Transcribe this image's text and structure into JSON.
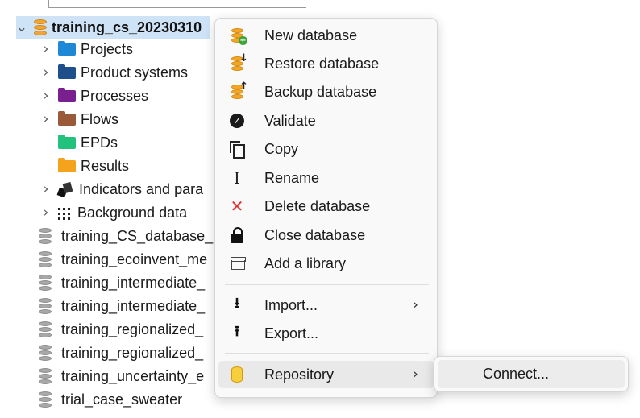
{
  "tree": {
    "selected_db": "training_cs_20230310",
    "children": [
      {
        "label": "Projects",
        "icon": "folder-icon",
        "color": "#1e88d6"
      },
      {
        "label": "Product systems",
        "icon": "folder-icon",
        "color": "#1f4f8a"
      },
      {
        "label": "Processes",
        "icon": "folder-icon",
        "color": "#7a1f8f"
      },
      {
        "label": "Flows",
        "icon": "folder-icon",
        "color": "#9a5a3a"
      },
      {
        "label": "EPDs",
        "icon": "folder-icon",
        "color": "#22c27c"
      },
      {
        "label": "Results",
        "icon": "folder-icon",
        "color": "#f5a21c"
      },
      {
        "label": "Indicators and para",
        "icon": "indicators-icon"
      },
      {
        "label": "Background data",
        "icon": "background-data-icon"
      }
    ],
    "databases": [
      "training_CS_database_",
      "training_ecoinvent_me",
      "training_intermediate_",
      "training_intermediate_",
      "training_regionalized_",
      "training_regionalized_",
      "training_uncertainty_e",
      "trial_case_sweater"
    ]
  },
  "context_menu": {
    "items": [
      {
        "label": "New database",
        "icon": "new-database-icon"
      },
      {
        "label": "Restore database",
        "icon": "restore-database-icon"
      },
      {
        "label": "Backup database",
        "icon": "backup-database-icon"
      },
      {
        "label": "Validate",
        "icon": "check-circle-icon"
      },
      {
        "label": "Copy",
        "icon": "copy-icon"
      },
      {
        "label": "Rename",
        "icon": "text-cursor-icon"
      },
      {
        "label": "Delete database",
        "icon": "delete-x-icon"
      },
      {
        "label": "Close database",
        "icon": "lock-icon"
      },
      {
        "label": "Add a library",
        "icon": "archive-icon"
      },
      {
        "label": "Import...",
        "icon": "import-icon"
      },
      {
        "label": "Export...",
        "icon": "export-icon"
      },
      {
        "label": "Repository",
        "icon": "repository-icon"
      }
    ]
  },
  "submenu": {
    "items": [
      {
        "label": "Connect..."
      }
    ]
  },
  "colors": {
    "selection": "#cfe3f7",
    "delete_icon": "#e03131",
    "database_icon": "#f3a532"
  }
}
